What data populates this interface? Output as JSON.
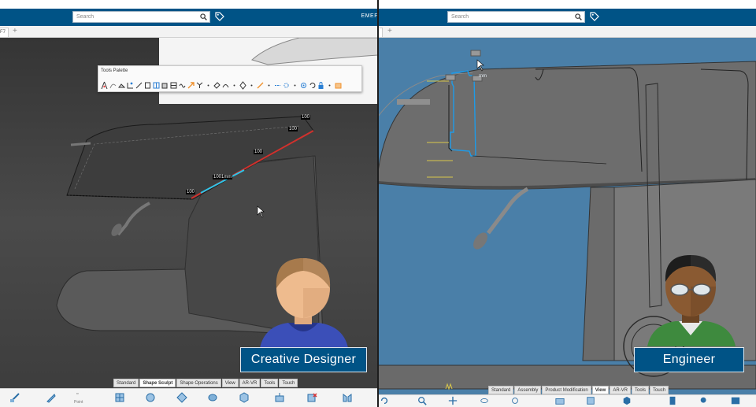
{
  "left": {
    "search_placeholder": "Search",
    "tab_label": "F7",
    "tab_plus": "+",
    "palette_title": "Tools Palette",
    "dimensions": [
      "100",
      "100",
      "100",
      "1001mm",
      "100"
    ],
    "section_tabs": [
      "Standard",
      "Shape Sculpt",
      "Shape Operations",
      "View",
      "AR-VR",
      "Tools",
      "Touch"
    ],
    "active_section": "Shape Sculpt",
    "persona_label": "Creative Designer",
    "action_caption": "Point"
  },
  "right": {
    "search_placeholder": "Search",
    "brand_text": "EMEF",
    "tab_plus": "+",
    "section_tabs": [
      "Standard",
      "Assembly",
      "Product Modification",
      "View",
      "AR-VR",
      "Tools",
      "Touch"
    ],
    "active_section": "View",
    "persona_label": "Engineer",
    "annotation": "mm"
  },
  "colors": {
    "brand_blue": "#005386",
    "dimension_red": "#d0312d",
    "dimension_cyan": "#2ec4e8",
    "sketch_blue": "#1e9be8",
    "viewport_blue": "#4a7fa8",
    "palette_orange": "#f0912e"
  }
}
